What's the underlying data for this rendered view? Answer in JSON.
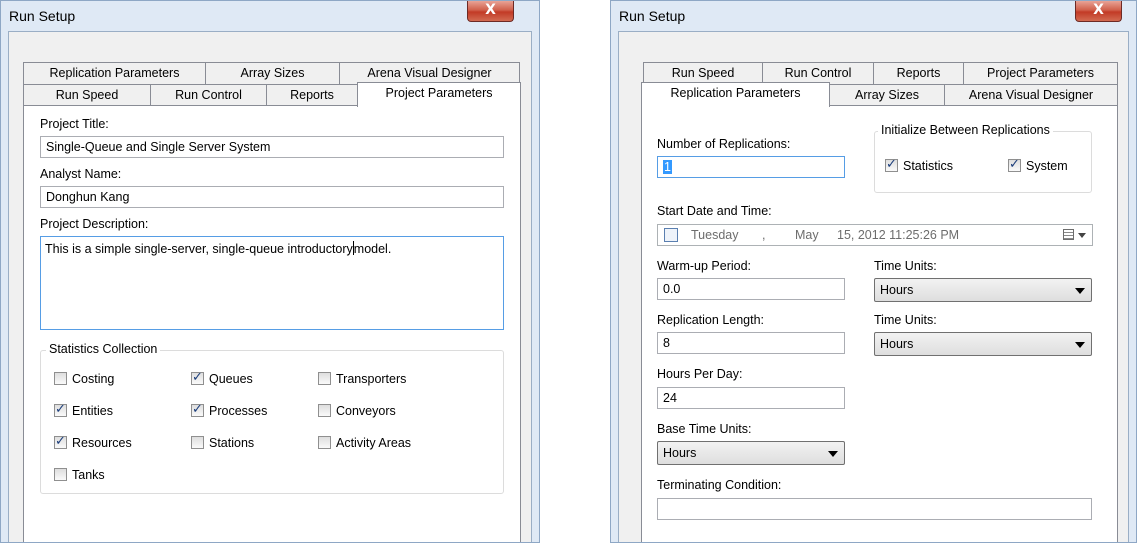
{
  "left": {
    "title": "Run Setup",
    "close": "X",
    "tabs_row_back": [
      "Replication Parameters",
      "Array Sizes",
      "Arena Visual Designer"
    ],
    "tabs_row_front": [
      "Run Speed",
      "Run Control",
      "Reports",
      "Project Parameters"
    ],
    "active_tab": "Project Parameters",
    "project_title": {
      "label": "Project Title:",
      "value": "Single-Queue and Single Server System"
    },
    "analyst_name": {
      "label": "Analyst Name:",
      "value": "Donghun Kang"
    },
    "project_description": {
      "label": "Project Description:",
      "value_before_cursor": "This is a simple single-server, single-queue introductory",
      "value_after_cursor": "model."
    },
    "statistics": {
      "title": "Statistics Collection",
      "items": [
        {
          "label": "Costing",
          "checked": false
        },
        {
          "label": "Queues",
          "checked": true
        },
        {
          "label": "Transporters",
          "checked": false
        },
        {
          "label": "Entities",
          "checked": true
        },
        {
          "label": "Processes",
          "checked": true
        },
        {
          "label": "Conveyors",
          "checked": false
        },
        {
          "label": "Resources",
          "checked": true
        },
        {
          "label": "Stations",
          "checked": false
        },
        {
          "label": "Activity Areas",
          "checked": false
        },
        {
          "label": "Tanks",
          "checked": false
        }
      ]
    }
  },
  "right": {
    "title": "Run Setup",
    "close": "X",
    "tabs_row_back": [
      "Run Speed",
      "Run Control",
      "Reports",
      "Project Parameters"
    ],
    "tabs_row_front": [
      "Replication Parameters",
      "Array Sizes",
      "Arena Visual Designer"
    ],
    "active_tab": "Replication Parameters",
    "num_replications": {
      "label": "Number of Replications:",
      "value": "1"
    },
    "initialize": {
      "title": "Initialize Between Replications",
      "statistics": {
        "label": "Statistics",
        "checked": true
      },
      "system": {
        "label": "System",
        "checked": true
      }
    },
    "start_date": {
      "label": "Start Date and Time:",
      "checked": false,
      "weekday": "Tuesday",
      "sep": ",",
      "month": "May",
      "day_year_time": "15, 2012  11:25:26 PM"
    },
    "warmup": {
      "label": "Warm-up Period:",
      "value": "0.0"
    },
    "warmup_units": {
      "label": "Time Units:",
      "value": "Hours"
    },
    "rep_length": {
      "label": "Replication Length:",
      "value": "8"
    },
    "rep_length_units": {
      "label": "Time Units:",
      "value": "Hours"
    },
    "hours_per_day": {
      "label": "Hours Per Day:",
      "value": "24"
    },
    "base_time_units": {
      "label": "Base Time Units:",
      "value": "Hours"
    },
    "terminating": {
      "label": "Terminating Condition:",
      "value": ""
    }
  }
}
